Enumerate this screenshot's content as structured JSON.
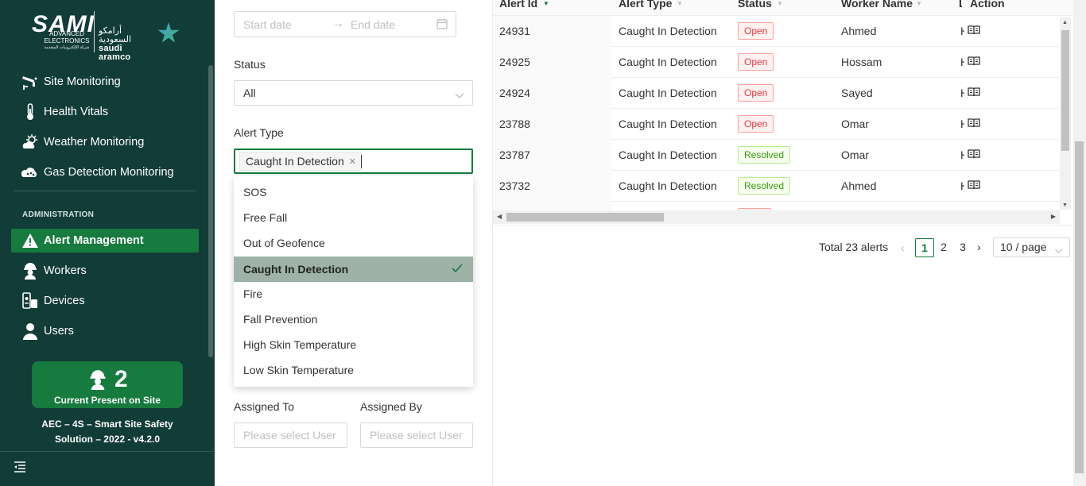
{
  "brand": {
    "sami": "SAMI",
    "advanced_line1": "ADVANCED",
    "advanced_line2": "ELECTRONICS",
    "advanced_ar": "شركة الإلكترونيات المتقدمة",
    "aramco_ar": "أرامكو السعودية",
    "aramco_en": "saudi aramco"
  },
  "sidebar": {
    "monitoring": [
      {
        "label": "Site Monitoring",
        "icon": "cctv-camera-icon"
      },
      {
        "label": "Health Vitals",
        "icon": "thermometer-icon"
      },
      {
        "label": "Weather Monitoring",
        "icon": "weather-sun-cloud-icon"
      },
      {
        "label": "Gas Detection Monitoring",
        "icon": "gas-cloud-icon"
      }
    ],
    "admin_label": "ADMINISTRATION",
    "admin": [
      {
        "label": "Alert Management",
        "icon": "warning-icon",
        "active": true
      },
      {
        "label": "Workers",
        "icon": "hard-hat-worker-icon"
      },
      {
        "label": "Devices",
        "icon": "devices-icon"
      },
      {
        "label": "Users",
        "icon": "user-icon"
      }
    ],
    "present_count": "2",
    "present_label": "Current Present on Site",
    "footer_line1": "AEC – 4S – Smart Site Safety",
    "footer_line2": "Solution – 2022 - v4.2.0"
  },
  "filters": {
    "start_placeholder": "Start date",
    "end_placeholder": "End date",
    "status_label": "Status",
    "status_value": "All",
    "alert_type_label": "Alert Type",
    "alert_type_tag": "Caught In Detection",
    "alert_type_options": [
      "SOS",
      "Free Fall",
      "Out of Geofence",
      "Caught In Detection",
      "Fire",
      "Fall Prevention",
      "High Skin Temperature",
      "Low Skin Temperature"
    ],
    "alert_type_selected": "Caught In Detection",
    "assigned_to_label": "Assigned To",
    "assigned_to_placeholder": "Please select User",
    "assigned_by_label": "Assigned By",
    "assigned_by_placeholder": "Please select User"
  },
  "table": {
    "headers": {
      "id": "Alert Id",
      "type": "Alert Type",
      "status": "Status",
      "worker": "Worker Name",
      "extra": "L",
      "action": "Action"
    },
    "rows": [
      {
        "id": "24931",
        "type": "Caught In Detection",
        "status": "Open",
        "worker": "Ahmed",
        "extra": "H"
      },
      {
        "id": "24925",
        "type": "Caught In Detection",
        "status": "Open",
        "worker": "Hossam",
        "extra": "H"
      },
      {
        "id": "24924",
        "type": "Caught In Detection",
        "status": "Open",
        "worker": "Sayed",
        "extra": "H"
      },
      {
        "id": "23788",
        "type": "Caught In Detection",
        "status": "Open",
        "worker": "Omar",
        "extra": "H"
      },
      {
        "id": "23787",
        "type": "Caught In Detection",
        "status": "Resolved",
        "worker": "Omar",
        "extra": "H"
      },
      {
        "id": "23732",
        "type": "Caught In Detection",
        "status": "Resolved",
        "worker": "Ahmed",
        "extra": "H"
      }
    ]
  },
  "pagination": {
    "total": "Total 23 alerts",
    "pages": [
      "1",
      "2",
      "3"
    ],
    "current": "1",
    "page_size": "10 / page"
  },
  "colors": {
    "sidebar_bg": "#123c38",
    "accent_green": "#177a3e",
    "selected_option": "#9eb2a8",
    "open_red": "#e6393e",
    "resolved_green": "#389e0d"
  }
}
